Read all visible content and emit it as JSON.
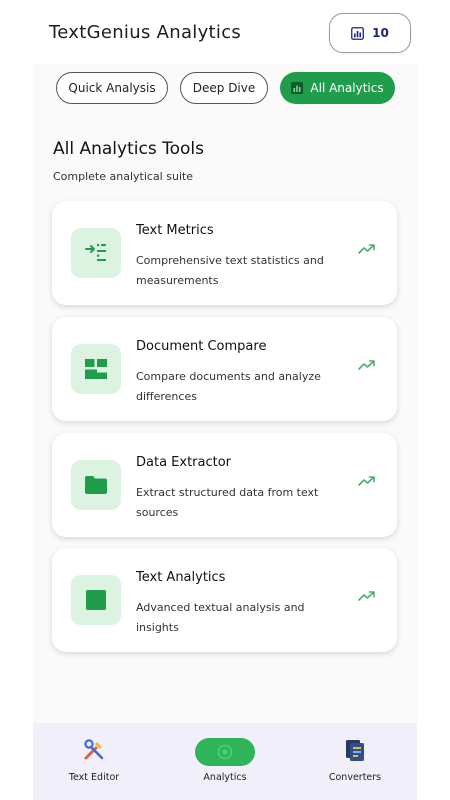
{
  "header": {
    "title": "TextGenius Analytics",
    "count": "10"
  },
  "filters": [
    {
      "label": "Quick Analysis",
      "active": false
    },
    {
      "label": "Deep Dive",
      "active": false
    },
    {
      "label": "All Analytics",
      "active": true
    }
  ],
  "section": {
    "title": "All Analytics Tools",
    "subtitle": "Complete analytical suite"
  },
  "cards": [
    {
      "title": "Text Metrics",
      "description": "Comprehensive text statistics and measurements",
      "icon": "text-metrics-icon"
    },
    {
      "title": "Document Compare",
      "description": "Compare documents and analyze differences",
      "icon": "dashboard-icon"
    },
    {
      "title": "Data Extractor",
      "description": "Extract structured data from text sources",
      "icon": "folder-icon"
    },
    {
      "title": "Text Analytics",
      "description": "Advanced textual analysis and insights",
      "icon": "square-icon"
    }
  ],
  "bottom_nav": [
    {
      "label": "Text Editor",
      "icon": "tools-icon",
      "active": false
    },
    {
      "label": "Analytics",
      "icon": "analytics-icon",
      "active": true
    },
    {
      "label": "Converters",
      "icon": "converter-icon",
      "active": false
    }
  ],
  "colors": {
    "accent": "#1f9d4b",
    "icon_bg": "#dcf3e2",
    "icon_fg": "#1f9d4b",
    "nav_bg": "#f1f0fa"
  }
}
